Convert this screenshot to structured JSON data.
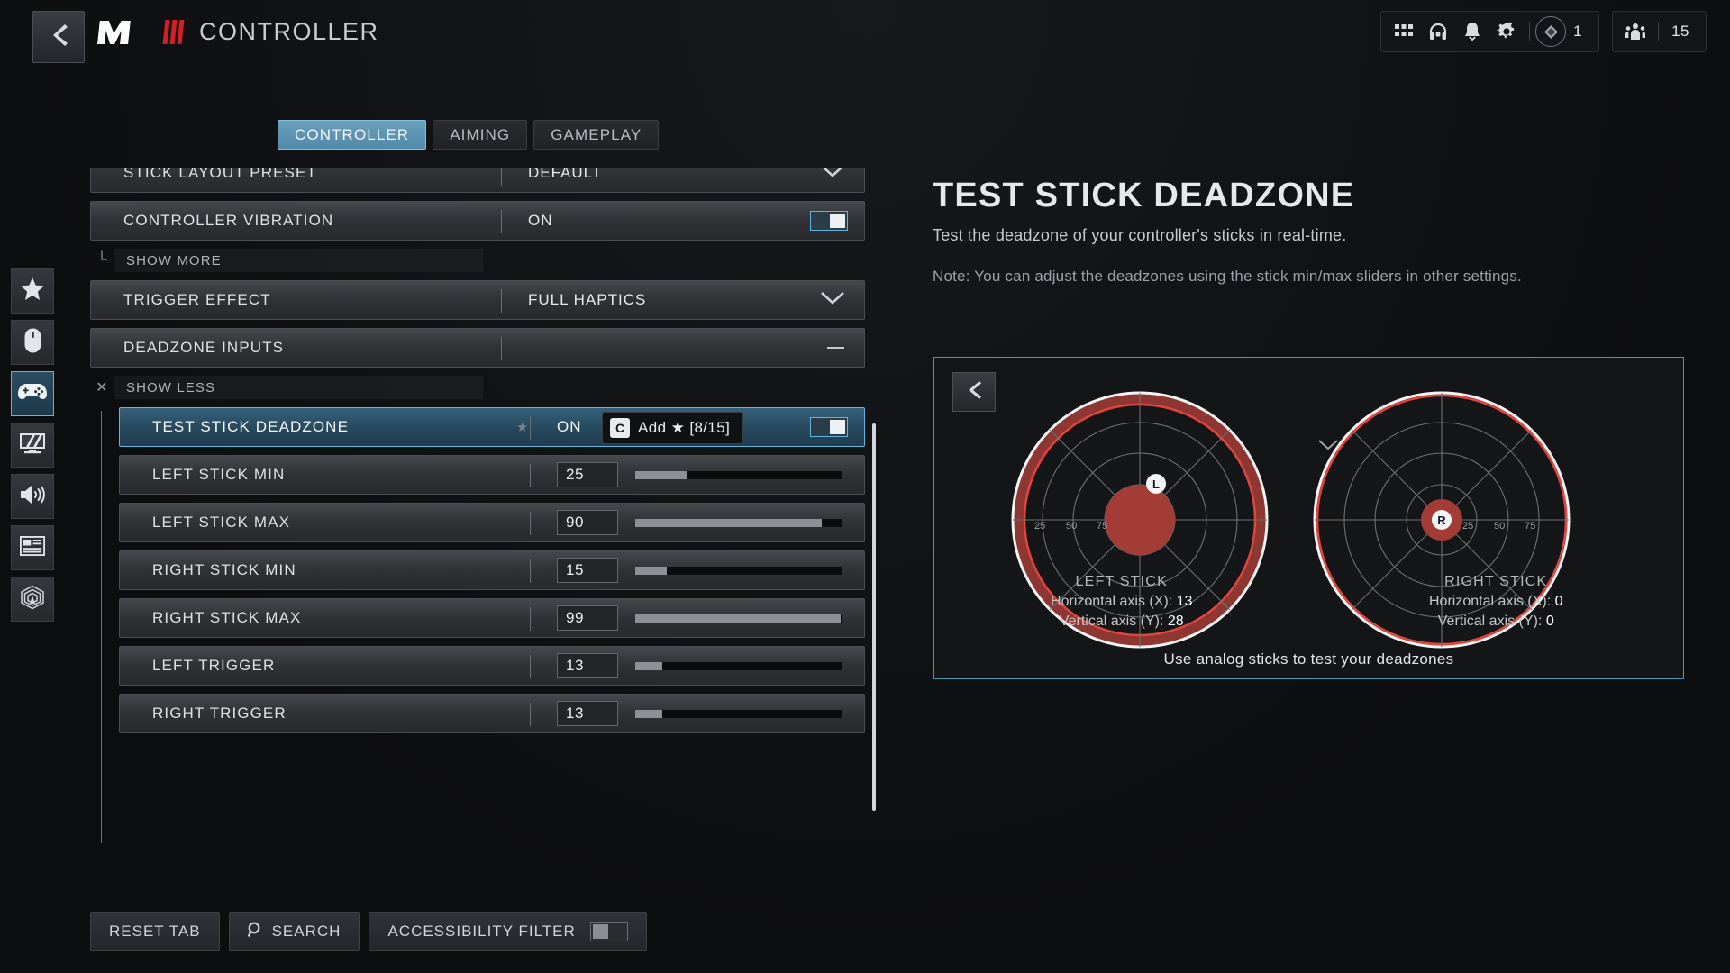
{
  "header": {
    "back_icon": "chevron-left-icon",
    "logo_text": "MW",
    "title": "CONTROLLER",
    "icons": [
      "grid-apps-icon",
      "headset-icon",
      "bell-icon",
      "gear-icon"
    ],
    "rank_value": "1",
    "squad_value": "15"
  },
  "rail": [
    {
      "name": "favorites",
      "icon": "star-icon"
    },
    {
      "name": "mouse-keyboard",
      "icon": "mouse-icon"
    },
    {
      "name": "controller",
      "icon": "gamepad-icon"
    },
    {
      "name": "graphics",
      "icon": "monitor-icon"
    },
    {
      "name": "audio",
      "icon": "speaker-icon"
    },
    {
      "name": "interface",
      "icon": "layout-icon"
    },
    {
      "name": "telemetry",
      "icon": "radar-icon"
    }
  ],
  "tabs": [
    {
      "label": "CONTROLLER",
      "active": true
    },
    {
      "label": "AIMING",
      "active": false
    },
    {
      "label": "GAMEPLAY",
      "active": false
    }
  ],
  "settings": {
    "stick_layout_preset": {
      "label": "STICK LAYOUT PRESET",
      "value": "DEFAULT"
    },
    "controller_vibration": {
      "label": "CONTROLLER VIBRATION",
      "value": "ON"
    },
    "show_more": {
      "label": "SHOW MORE",
      "mark": "└"
    },
    "trigger_effect": {
      "label": "TRIGGER EFFECT",
      "value": "FULL HAPTICS"
    },
    "deadzone_inputs": {
      "label": "DEADZONE INPUTS",
      "value": ""
    },
    "show_less": {
      "label": "SHOW LESS",
      "mark": "✕"
    },
    "test_stick_deadzone": {
      "label": "TEST STICK DEADZONE",
      "value": "ON",
      "star": "★"
    },
    "left_stick_min": {
      "label": "LEFT STICK MIN",
      "value": "25",
      "percent": 25
    },
    "left_stick_max": {
      "label": "LEFT STICK MAX",
      "value": "90",
      "percent": 90
    },
    "right_stick_min": {
      "label": "RIGHT STICK MIN",
      "value": "15",
      "percent": 15
    },
    "right_stick_max": {
      "label": "RIGHT STICK MAX",
      "value": "99",
      "percent": 99
    },
    "left_trigger": {
      "label": "LEFT TRIGGER",
      "value": "13",
      "percent": 13
    },
    "right_trigger": {
      "label": "RIGHT TRIGGER",
      "value": "13",
      "percent": 13
    }
  },
  "tooltip": {
    "key": "C",
    "text": "Add ★ [8/15]"
  },
  "detail": {
    "title": "TEST STICK DEADZONE",
    "description": "Test the deadzone of your controller's sticks in real-time.",
    "note": "Note: You can adjust the deadzones using the stick min/max sliders in other settings."
  },
  "test_panel": {
    "back_icon": "chevron-left-icon",
    "hint": "Use analog sticks to test your deadzones",
    "tick_labels": [
      "25",
      "50",
      "75"
    ],
    "left_stick": {
      "name": "LEFT STICK",
      "marker": "L",
      "x_label": "Horizontal axis (X):",
      "x_value": "13",
      "y_label": "Vertical axis (Y):",
      "y_value": "28",
      "inner_deadzone": 25,
      "outer_deadzone": 90
    },
    "right_stick": {
      "name": "RIGHT STICK",
      "marker": "R",
      "x_label": "Horizontal axis (X):",
      "x_value": "0",
      "y_label": "Vertical axis (Y):",
      "y_value": "0",
      "inner_deadzone": 15,
      "outer_deadzone": 99
    }
  },
  "bottom": {
    "reset_tab": "RESET TAB",
    "search": "SEARCH",
    "search_icon": "magnifier-icon",
    "accessibility_filter": "ACCESSIBILITY FILTER"
  },
  "colors": {
    "accent": "#5fb5dd",
    "brand_red": "#d32027",
    "deadzone_red": "#c0392f"
  }
}
